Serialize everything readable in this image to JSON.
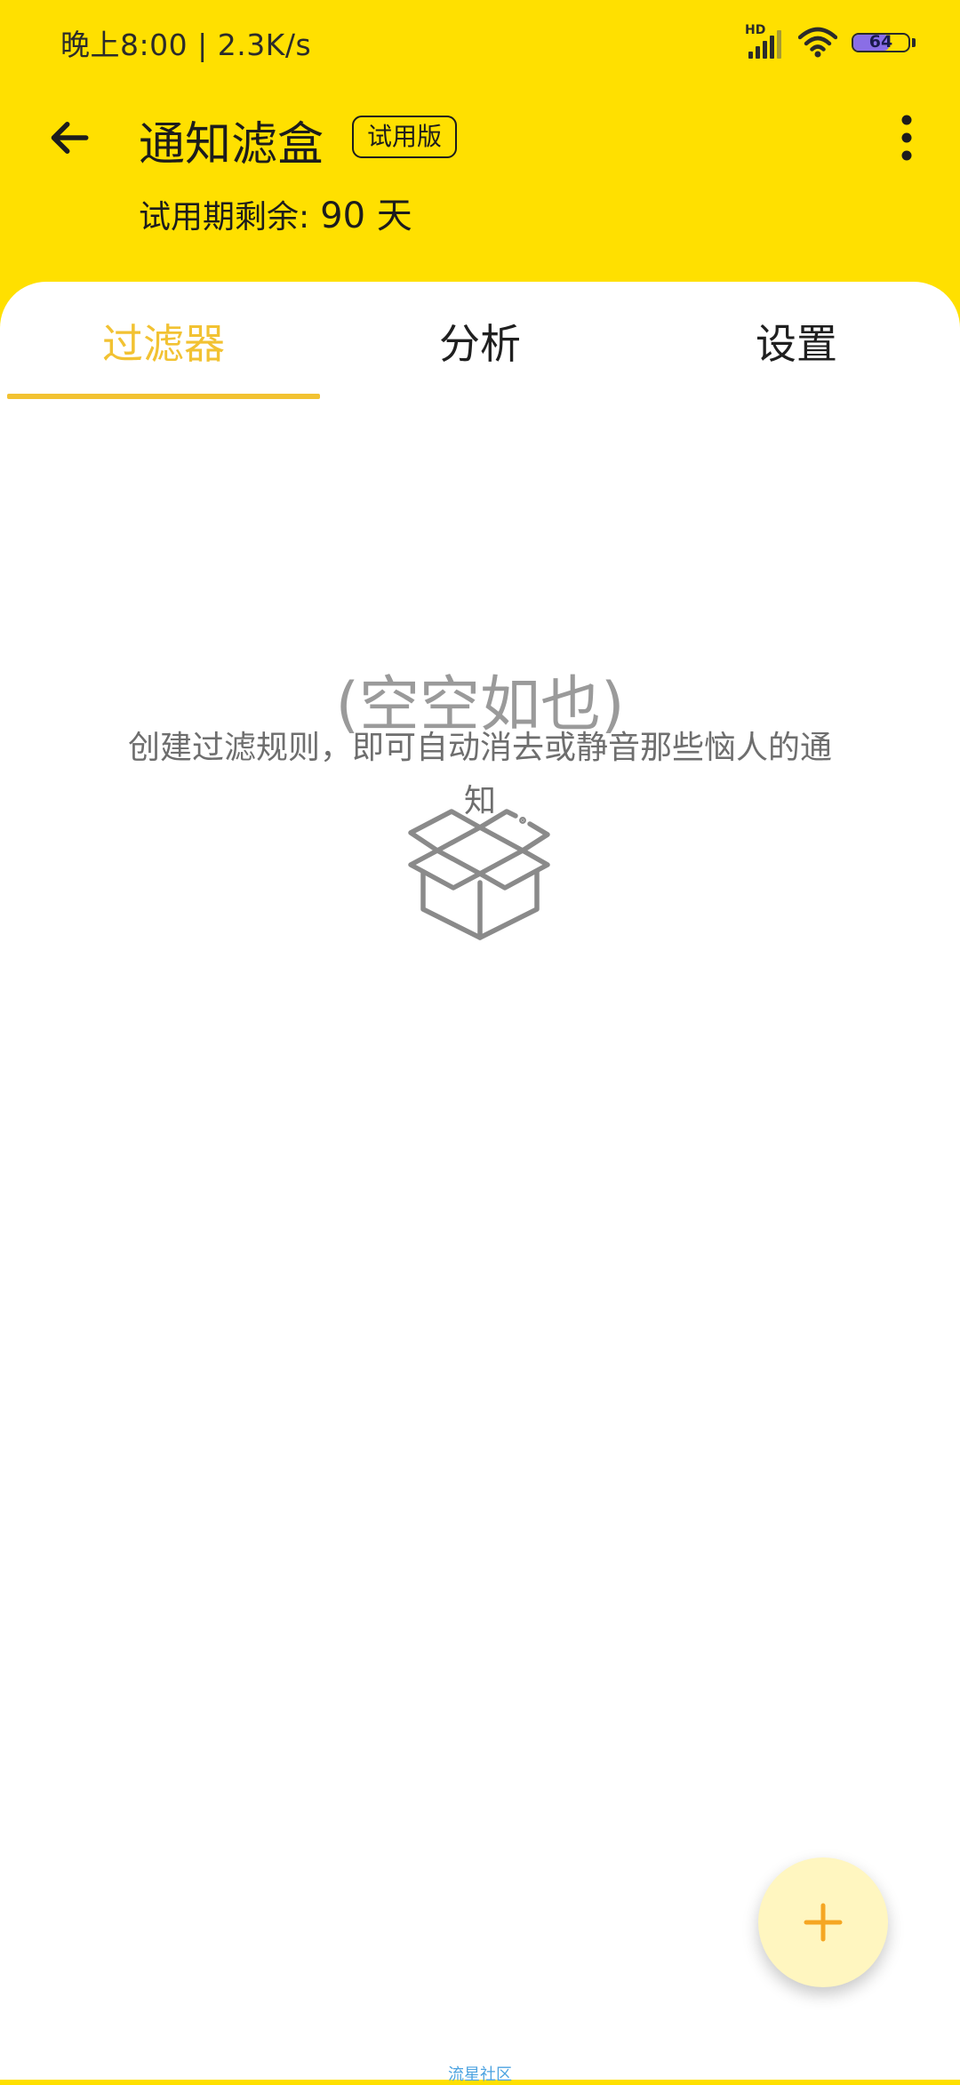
{
  "status_bar": {
    "time_speed": "晚上8:00 | 2.3K/s",
    "network_label": "HD",
    "battery_level": "64",
    "battery_fraction": 0.64
  },
  "app_bar": {
    "back_icon": "arrow-left-icon",
    "title": "通知滤盒",
    "badge": "试用版",
    "trial_label": "试用期剩余:",
    "trial_days": "90 天",
    "menu_icon": "more-vert-icon"
  },
  "tabs": [
    {
      "label": "过滤器",
      "active": true
    },
    {
      "label": "分析",
      "active": false
    },
    {
      "label": "设置",
      "active": false
    }
  ],
  "empty_state": {
    "icon": "open-box-icon",
    "title": "(空空如也)",
    "description": "创建过滤规则，即可自动消去或静音那些恼人的通知"
  },
  "fab": {
    "icon": "plus-icon"
  },
  "watermark": "流星社区",
  "colors": {
    "app_bar_bg": "#FFE000",
    "accent": "#F2C232",
    "fab_bg": "#FFF6C0",
    "fab_icon": "#F5A623"
  }
}
